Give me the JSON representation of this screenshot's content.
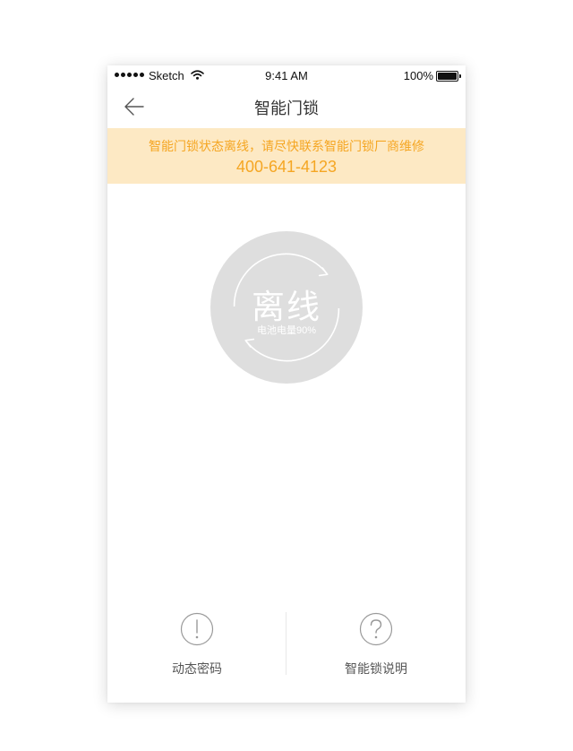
{
  "status_bar": {
    "carrier": "Sketch",
    "time": "9:41 AM",
    "battery": "100%"
  },
  "nav": {
    "title": "智能门锁",
    "back_icon": "arrow-left-icon"
  },
  "alert": {
    "message": "智能门锁状态离线，请尽快联系智能门锁厂商维修",
    "phone": "400-641-4123",
    "color": "#f5a623",
    "background": "#fde9c4"
  },
  "lock_status": {
    "status": "离线",
    "battery": "电池电量90%",
    "circle_color": "#dedede"
  },
  "bottom_actions": [
    {
      "label": "动态密码",
      "icon": "exclamation-circle-icon"
    },
    {
      "label": "智能锁说明",
      "icon": "question-circle-icon"
    }
  ]
}
